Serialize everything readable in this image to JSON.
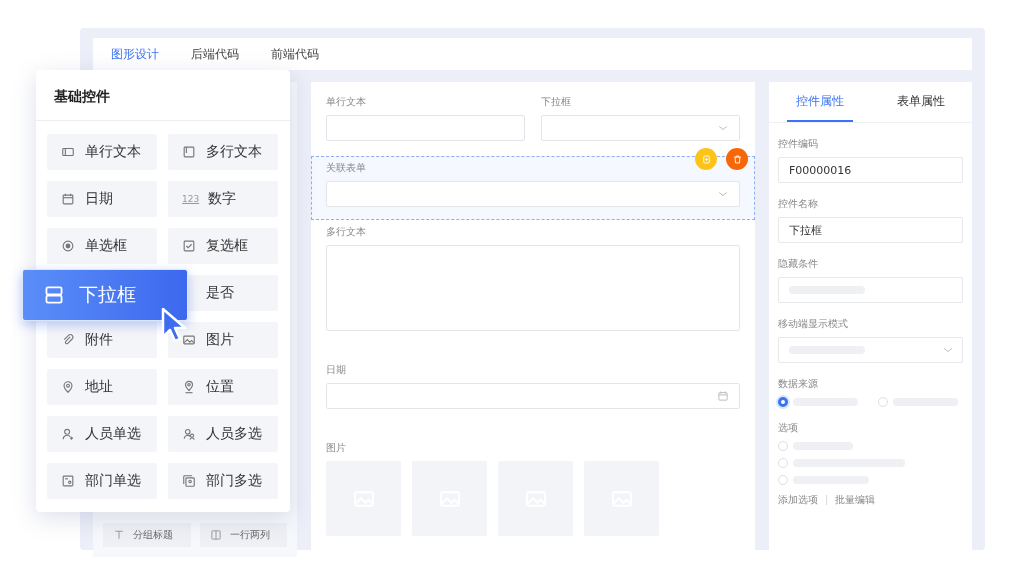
{
  "top_tabs": [
    {
      "label": "图形设计",
      "selected": true
    },
    {
      "label": "后端代码",
      "selected": false
    },
    {
      "label": "前端代码",
      "selected": false
    }
  ],
  "palette": {
    "title": "基础控件",
    "items": [
      {
        "label": "单行文本",
        "kind": "text",
        "dragging": false
      },
      {
        "label": "多行文本",
        "kind": "textarea",
        "dragging": false
      },
      {
        "label": "日期",
        "kind": "date",
        "dragging": false
      },
      {
        "label": "数字",
        "kind": "number",
        "icon_text": "123",
        "dragging": false
      },
      {
        "label": "单选框",
        "kind": "radio",
        "dragging": false
      },
      {
        "label": "复选框",
        "kind": "checkbox",
        "dragging": false
      },
      {
        "label": "下拉框",
        "kind": "select",
        "dragging": true
      },
      {
        "label": "是否",
        "kind": "toggle",
        "dragging": false
      },
      {
        "label": "附件",
        "kind": "attachment",
        "dragging": false
      },
      {
        "label": "图片",
        "kind": "image",
        "dragging": false
      },
      {
        "label": "地址",
        "kind": "address",
        "dragging": false
      },
      {
        "label": "位置",
        "kind": "position",
        "dragging": false
      },
      {
        "label": "人员单选",
        "kind": "user",
        "dragging": false
      },
      {
        "label": "人员多选",
        "kind": "users",
        "dragging": false
      },
      {
        "label": "部门单选",
        "kind": "dept",
        "dragging": false
      },
      {
        "label": "部门多选",
        "kind": "depts",
        "dragging": false
      }
    ]
  },
  "left_buttons": [
    {
      "label": "分组标题",
      "kind": "heading"
    },
    {
      "label": "一行两列",
      "kind": "columns"
    }
  ],
  "canvas": {
    "rows": [
      {
        "selected": false,
        "fields": [
          {
            "label": "单行文本",
            "kind": "text"
          },
          {
            "label": "下拉框",
            "kind": "select"
          }
        ]
      },
      {
        "selected": true,
        "fields": [
          {
            "label": "关联表单",
            "kind": "select"
          }
        ]
      },
      {
        "selected": false,
        "fields": [
          {
            "label": "多行文本",
            "kind": "textarea"
          }
        ]
      },
      {
        "selected": false,
        "fields": [
          {
            "label": "日期",
            "kind": "date"
          }
        ]
      },
      {
        "selected": false,
        "fields": [
          {
            "label": "图片",
            "kind": "images",
            "tiles": [
              {
                "kind": "image"
              },
              {
                "kind": "image"
              },
              {
                "kind": "image"
              },
              {
                "kind": "image"
              }
            ]
          }
        ]
      }
    ],
    "actions": [
      {
        "kind": "copy",
        "color": "#fcc419"
      },
      {
        "kind": "delete",
        "color": "#f76707"
      }
    ]
  },
  "properties": {
    "tabs": [
      {
        "label": "控件属性",
        "selected": true
      },
      {
        "label": "表单属性",
        "selected": false
      }
    ],
    "fields": [
      {
        "label": "控件编码",
        "kind": "input",
        "value": "F00000016"
      },
      {
        "label": "控件名称",
        "kind": "input",
        "value": "下拉框"
      },
      {
        "label": "隐藏条件",
        "kind": "input"
      },
      {
        "label": "移动端显示模式",
        "kind": "select"
      },
      {
        "label": "数据来源",
        "kind": "radio-row",
        "options": [
          {
            "selected": true
          },
          {
            "selected": false
          }
        ]
      },
      {
        "label": "选项",
        "kind": "radio-list",
        "options": [
          {
            "selected": false
          },
          {
            "selected": false
          },
          {
            "selected": false
          }
        ]
      }
    ],
    "links": [
      "添加选项",
      "批量编辑"
    ]
  }
}
